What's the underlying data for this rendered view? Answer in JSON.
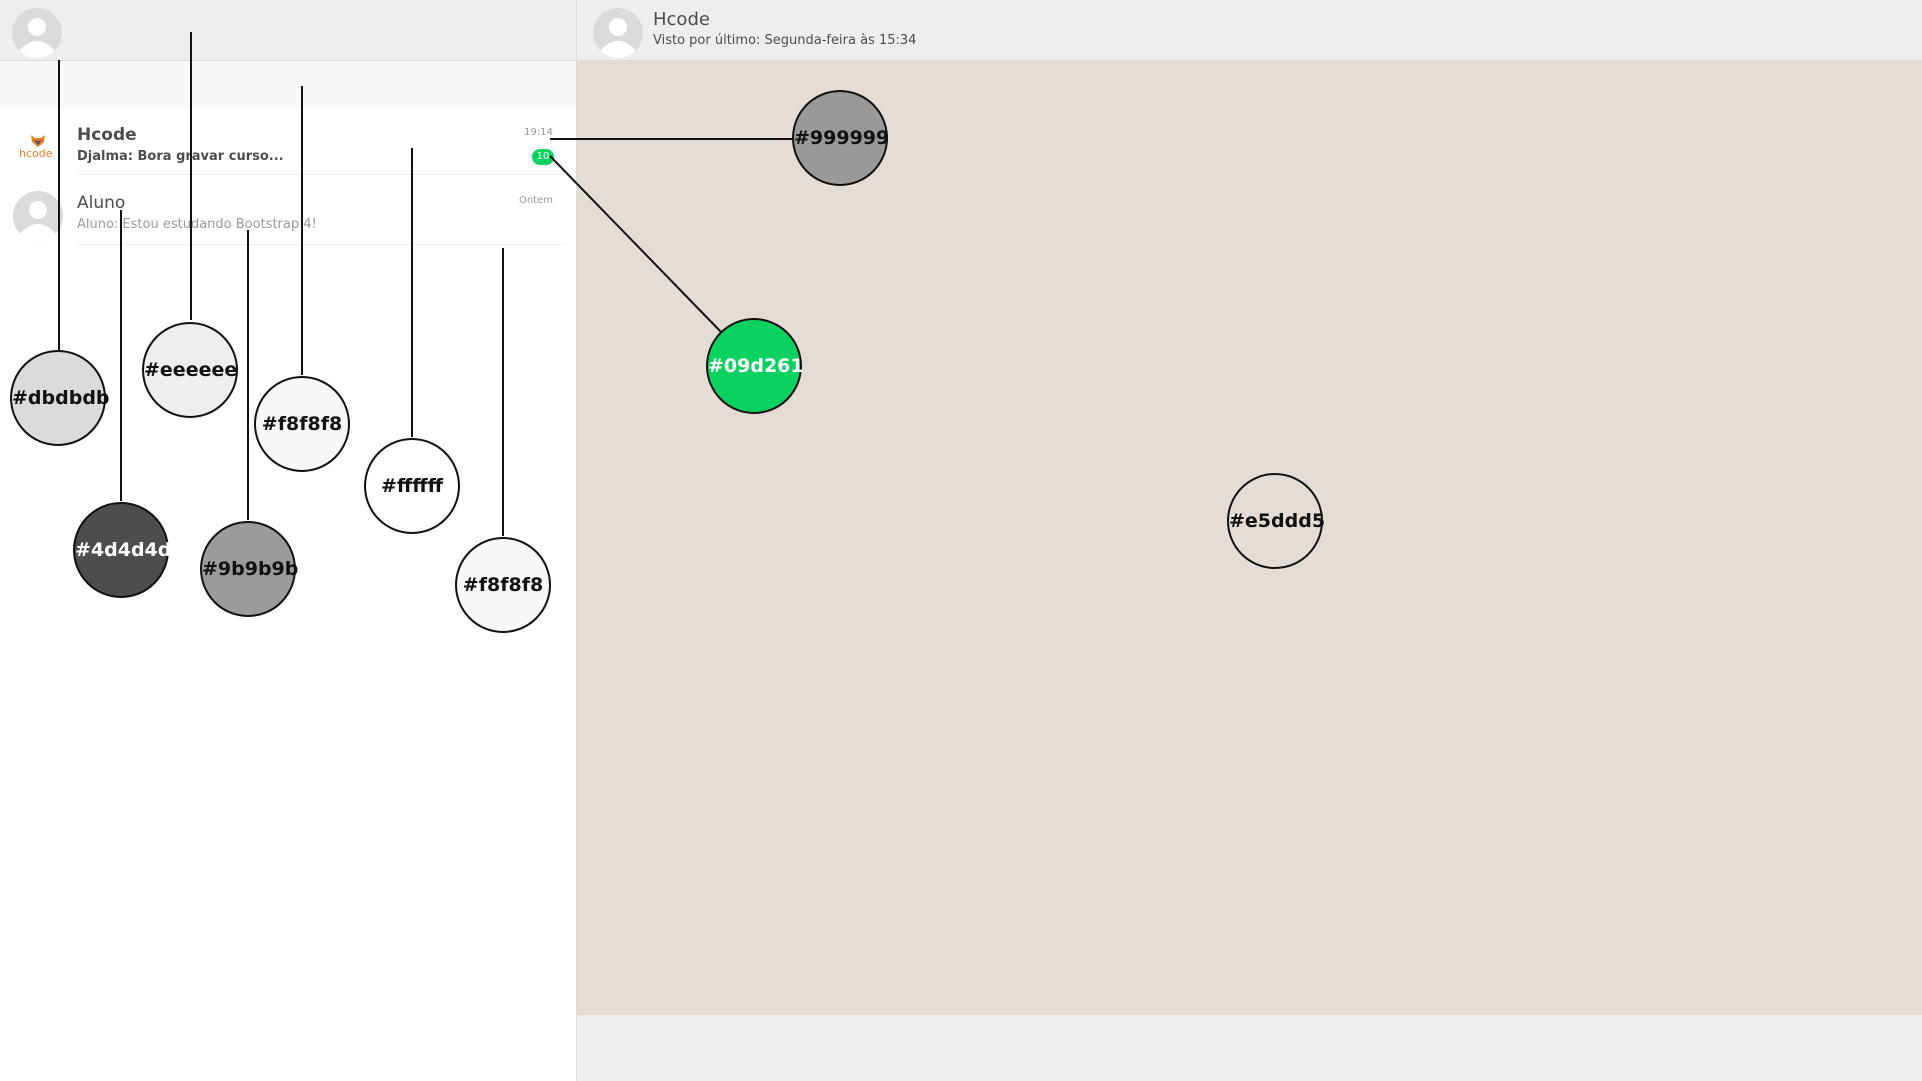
{
  "sidebar": {
    "chats": [
      {
        "name": "Hcode",
        "preview": "Djalma: Bora gravar curso...",
        "time": "19:14",
        "unread_count": "10",
        "logo_text": "hcode",
        "avatar_icon": "hcode-logo"
      },
      {
        "name": "Aluno",
        "preview": "Aluno: Estou estudando Bootstrap 4!",
        "time": "Ontem",
        "avatar_icon": "person-icon"
      }
    ]
  },
  "conversation": {
    "contact_name": "Hcode",
    "last_seen": "Visto por último: Segunda-feira às 15:34"
  },
  "annotations": [
    {
      "label": "#dbdbdb",
      "color": "#dbdbdb"
    },
    {
      "label": "#eeeeee",
      "color": "#eeeeee"
    },
    {
      "label": "#f8f8f8",
      "color": "#f8f8f8"
    },
    {
      "label": "#ffffff",
      "color": "#ffffff"
    },
    {
      "label": "#4d4d4d",
      "color": "#4d4d4d"
    },
    {
      "label": "#9b9b9b",
      "color": "#9b9b9b"
    },
    {
      "label": "#f8f8f8",
      "color": "#f8f8f8"
    },
    {
      "label": "#999999",
      "color": "#999999"
    },
    {
      "label": "#09d261",
      "color": "#09d261"
    },
    {
      "label": "#e5ddd5",
      "color": "#e5ddd5"
    }
  ],
  "colors": {
    "badge": "#09d261",
    "chat_background": "#e5ddd5",
    "header": "#eeeeee",
    "search_bar": "#f8f8f8",
    "avatar_placeholder": "#dbdbdb"
  }
}
